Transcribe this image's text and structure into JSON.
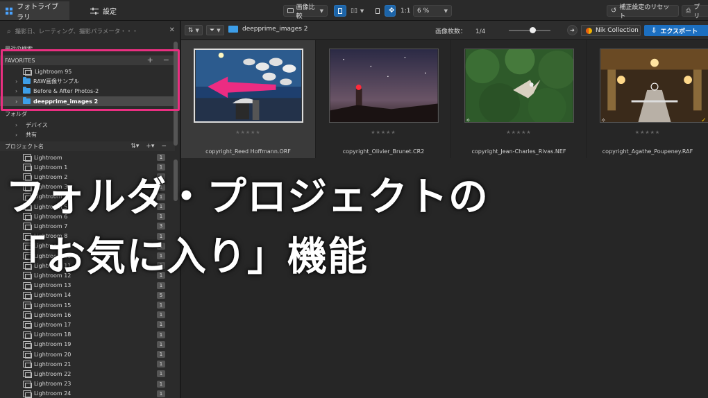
{
  "topbar": {
    "tab_library": "フォトライブラリ",
    "tab_settings": "設定",
    "compare": "画像比較",
    "ratio": "1:1",
    "zoom": "6 %",
    "reset": "補正設定のリセット",
    "print": "プリ"
  },
  "sidebar": {
    "search_placeholder": "撮影日、レーティング、撮影パラメータ・・・",
    "recent_search": "最近の検索",
    "favorites_header": "FAVORITES",
    "favorites": [
      {
        "label": "Lightroom 95",
        "type": "project"
      },
      {
        "label": "RAW画像サンプル",
        "type": "folder"
      },
      {
        "label": "Before & After Photos-2",
        "type": "folder"
      },
      {
        "label": "deepprime_images 2",
        "type": "folder"
      }
    ],
    "folders_header": "フォルダ",
    "folders": [
      "デバイス",
      "共有"
    ],
    "projects_header": "プロジェクト名",
    "projects": [
      {
        "label": "Lightroom",
        "count": "1"
      },
      {
        "label": "Lightroom 1",
        "count": "1"
      },
      {
        "label": "Lightroom 2",
        "count": "1"
      },
      {
        "label": "Lightroom 3",
        "count": "1"
      },
      {
        "label": "Lightroom 4",
        "count": "1"
      },
      {
        "label": "Lightroom 5",
        "count": "1"
      },
      {
        "label": "Lightroom 6",
        "count": "1"
      },
      {
        "label": "Lightroom 7",
        "count": "3"
      },
      {
        "label": "Lightroom 8",
        "count": "1"
      },
      {
        "label": "Lightroom 9",
        "count": "1"
      },
      {
        "label": "Lightroom 10",
        "count": "1"
      },
      {
        "label": "Lightroom 11",
        "count": "1"
      },
      {
        "label": "Lightroom 12",
        "count": "1"
      },
      {
        "label": "Lightroom 13",
        "count": "1"
      },
      {
        "label": "Lightroom 14",
        "count": "5"
      },
      {
        "label": "Lightroom 15",
        "count": "1"
      },
      {
        "label": "Lightroom 16",
        "count": "1"
      },
      {
        "label": "Lightroom 17",
        "count": "1"
      },
      {
        "label": "Lightroom 18",
        "count": "1"
      },
      {
        "label": "Lightroom 19",
        "count": "1"
      },
      {
        "label": "Lightroom 20",
        "count": "1"
      },
      {
        "label": "Lightroom 21",
        "count": "1"
      },
      {
        "label": "Lightroom 22",
        "count": "1"
      },
      {
        "label": "Lightroom 23",
        "count": "1"
      },
      {
        "label": "Lightroom 24",
        "count": "1"
      }
    ]
  },
  "browser": {
    "folder_name": "deepprime_images 2",
    "image_count_label": "画像枚数：",
    "image_count": "1/4",
    "nik": "Nik Collection",
    "export": "エクスポート",
    "thumbnails": [
      {
        "name": "copyright_Reed Hoffmann.ORF",
        "stars": "★★★★★"
      },
      {
        "name": "copyright_Olivier_Brunet.CR2",
        "stars": "★★★★★"
      },
      {
        "name": "copyright_Jean-Charles_Rivas.NEF",
        "stars": "★★★★★"
      },
      {
        "name": "copyright_Agathe_Poupeney.RAF",
        "stars": "★★★★★"
      }
    ]
  },
  "overlay": {
    "line1": "フォルダ・プロジェクトの",
    "line2": "「お気に入り」機能"
  },
  "colors": {
    "accent_blue": "#1c6fc0",
    "highlight_pink": "#ea2f81",
    "folder_blue": "#3d9ee8"
  }
}
